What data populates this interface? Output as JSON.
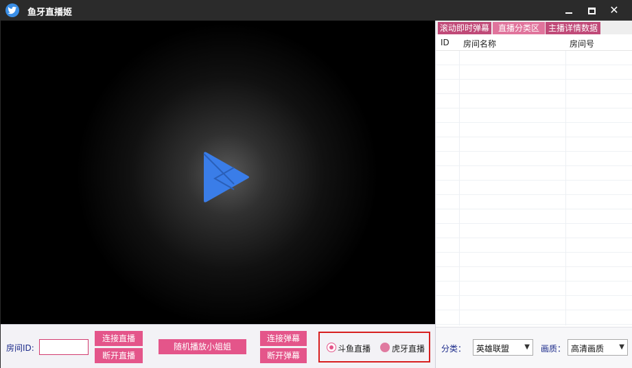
{
  "window": {
    "title": "鱼牙直播姬",
    "controls": {
      "minimize": "",
      "maximize": "",
      "close": "✕"
    }
  },
  "controls": {
    "room_id_label": "房间ID:",
    "room_id_value": "",
    "connect_live": "连接直播",
    "disconnect_live": "断开直播",
    "random_play": "随机播放小姐姐",
    "connect_danmaku": "连接弹幕",
    "disconnect_danmaku": "断开弹幕",
    "platforms": [
      {
        "label": "斗鱼直播",
        "selected": true
      },
      {
        "label": "虎牙直播",
        "selected": false
      }
    ]
  },
  "right_panel": {
    "tabs": [
      {
        "label": "滚动即时弹幕"
      },
      {
        "label": "直播分类区",
        "active": true
      },
      {
        "label": "主播详情数据"
      }
    ],
    "columns": [
      "ID",
      "房间名称",
      "房间号"
    ],
    "rows": [],
    "category_label": "分类：",
    "category_value": "英雄联盟",
    "quality_label": "画质：",
    "quality_value": "高清画质"
  },
  "colors": {
    "accent": "#e4558a",
    "tab": "#c04a78",
    "tab_active": "#e0749c",
    "label_text": "#1b2a8a",
    "highlight_border": "#d71e1e",
    "play_icon": "#3a7de8"
  }
}
